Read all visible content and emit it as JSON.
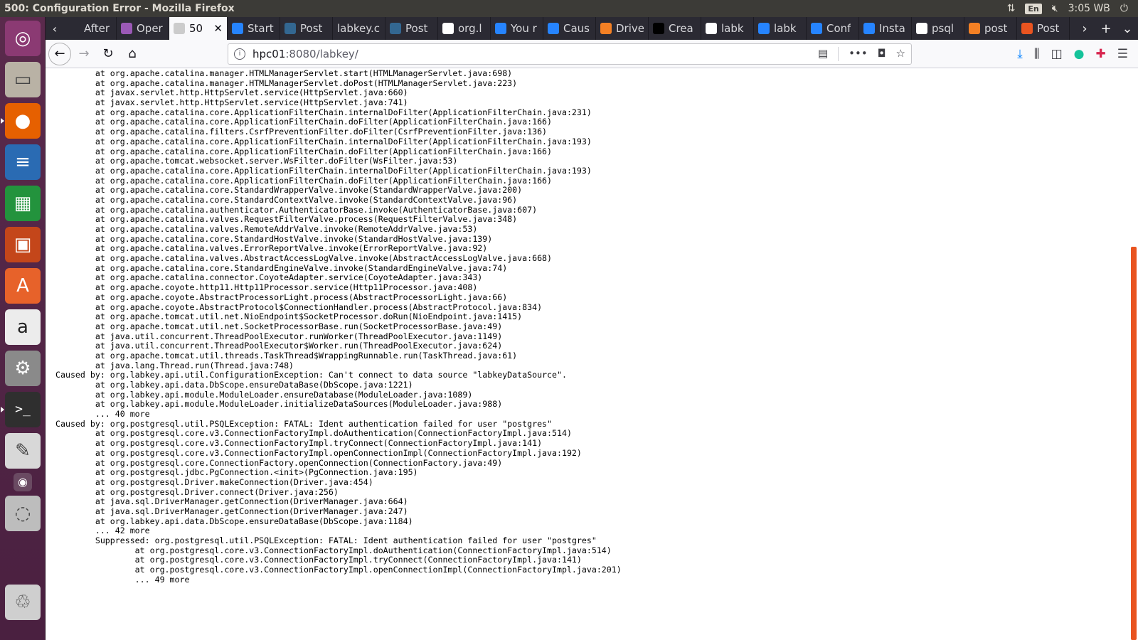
{
  "window": {
    "title": "500: Configuration Error - Mozilla Firefox",
    "tray": {
      "network_icon": "network-updown-icon",
      "keyboard": "En",
      "volume_icon": "volume-muted-icon",
      "clock": "3:05 WB",
      "power_icon": "power-icon"
    }
  },
  "launcher": {
    "items": [
      {
        "name": "ubuntu-dash-icon",
        "glyph": "◎",
        "color": "#8b3a73"
      },
      {
        "name": "files-icon",
        "glyph": "▭",
        "color": "#b9b2a5"
      },
      {
        "name": "firefox-icon",
        "glyph": "●",
        "color": "#e66000"
      },
      {
        "name": "writer-icon",
        "glyph": "≡",
        "color": "#2a6bb3"
      },
      {
        "name": "calc-icon",
        "glyph": "▦",
        "color": "#23933d"
      },
      {
        "name": "impress-icon",
        "glyph": "▣",
        "color": "#c4461a"
      },
      {
        "name": "software-center-icon",
        "glyph": "A",
        "color": "#e7622a"
      },
      {
        "name": "amazon-icon",
        "glyph": "a",
        "color": "#ececec"
      },
      {
        "name": "system-settings-icon",
        "glyph": "⚙",
        "color": "#8a8a8a"
      },
      {
        "name": "terminal-icon",
        "glyph": ">_",
        "color": "#2f2f2f"
      },
      {
        "name": "text-editor-icon",
        "glyph": "✎",
        "color": "#d8d8d8"
      },
      {
        "name": "camera-icon",
        "glyph": "◉",
        "color": "#6a4a62"
      },
      {
        "name": "disk-icon",
        "glyph": "◌",
        "color": "#bdbdbd"
      },
      {
        "name": "trash-icon",
        "glyph": "♲",
        "color": "#cfcfcf"
      }
    ]
  },
  "tabs": [
    {
      "label": "After",
      "icon": "back-arrow",
      "icon_color": "#2b2a33"
    },
    {
      "label": "Oper",
      "icon": "circle-icon",
      "icon_color": "#9b59b6"
    },
    {
      "label": "50",
      "icon": "image-icon",
      "icon_color": "#cccccc",
      "active": true
    },
    {
      "label": "Start",
      "icon": "atlassian-icon",
      "icon_color": "#2684ff"
    },
    {
      "label": "Post",
      "icon": "postgres-icon",
      "icon_color": "#336791"
    },
    {
      "label": "labkey.c",
      "icon": "",
      "icon_color": "#2b2a33"
    },
    {
      "label": "Post",
      "icon": "postgres-icon",
      "icon_color": "#336791"
    },
    {
      "label": "org.l",
      "icon": "google-icon",
      "icon_color": "#ffffff"
    },
    {
      "label": "You r",
      "icon": "atlassian-icon",
      "icon_color": "#2684ff"
    },
    {
      "label": "Caus",
      "icon": "atlassian-icon",
      "icon_color": "#2684ff"
    },
    {
      "label": "Drive",
      "icon": "stackoverflow-icon",
      "icon_color": "#f48024"
    },
    {
      "label": "Crea",
      "icon": "medium-icon",
      "icon_color": "#000000"
    },
    {
      "label": "labk",
      "icon": "google-icon",
      "icon_color": "#ffffff"
    },
    {
      "label": "labk",
      "icon": "atlassian-icon",
      "icon_color": "#2684ff"
    },
    {
      "label": "Conf",
      "icon": "atlassian-icon",
      "icon_color": "#2684ff"
    },
    {
      "label": "Insta",
      "icon": "atlassian-icon",
      "icon_color": "#2684ff"
    },
    {
      "label": "psql",
      "icon": "google-icon",
      "icon_color": "#ffffff"
    },
    {
      "label": "post",
      "icon": "stackoverflow-icon",
      "icon_color": "#f48024"
    },
    {
      "label": "Post",
      "icon": "ubuntu-icon",
      "icon_color": "#e95420"
    }
  ],
  "navbar": {
    "url_host": "hpc01",
    "url_rest": ":8080/labkey/",
    "more_label": "•••"
  },
  "trace_lines": [
    "        at org.apache.catalina.manager.HTMLManagerServlet.start(HTMLManagerServlet.java:698)",
    "        at org.apache.catalina.manager.HTMLManagerServlet.doPost(HTMLManagerServlet.java:223)",
    "        at javax.servlet.http.HttpServlet.service(HttpServlet.java:660)",
    "        at javax.servlet.http.HttpServlet.service(HttpServlet.java:741)",
    "        at org.apache.catalina.core.ApplicationFilterChain.internalDoFilter(ApplicationFilterChain.java:231)",
    "        at org.apache.catalina.core.ApplicationFilterChain.doFilter(ApplicationFilterChain.java:166)",
    "        at org.apache.catalina.filters.CsrfPreventionFilter.doFilter(CsrfPreventionFilter.java:136)",
    "        at org.apache.catalina.core.ApplicationFilterChain.internalDoFilter(ApplicationFilterChain.java:193)",
    "        at org.apache.catalina.core.ApplicationFilterChain.doFilter(ApplicationFilterChain.java:166)",
    "        at org.apache.tomcat.websocket.server.WsFilter.doFilter(WsFilter.java:53)",
    "        at org.apache.catalina.core.ApplicationFilterChain.internalDoFilter(ApplicationFilterChain.java:193)",
    "        at org.apache.catalina.core.ApplicationFilterChain.doFilter(ApplicationFilterChain.java:166)",
    "        at org.apache.catalina.core.StandardWrapperValve.invoke(StandardWrapperValve.java:200)",
    "        at org.apache.catalina.core.StandardContextValve.invoke(StandardContextValve.java:96)",
    "        at org.apache.catalina.authenticator.AuthenticatorBase.invoke(AuthenticatorBase.java:607)",
    "        at org.apache.catalina.valves.RequestFilterValve.process(RequestFilterValve.java:348)",
    "        at org.apache.catalina.valves.RemoteAddrValve.invoke(RemoteAddrValve.java:53)",
    "        at org.apache.catalina.core.StandardHostValve.invoke(StandardHostValve.java:139)",
    "        at org.apache.catalina.valves.ErrorReportValve.invoke(ErrorReportValve.java:92)",
    "        at org.apache.catalina.valves.AbstractAccessLogValve.invoke(AbstractAccessLogValve.java:668)",
    "        at org.apache.catalina.core.StandardEngineValve.invoke(StandardEngineValve.java:74)",
    "        at org.apache.catalina.connector.CoyoteAdapter.service(CoyoteAdapter.java:343)",
    "        at org.apache.coyote.http11.Http11Processor.service(Http11Processor.java:408)",
    "        at org.apache.coyote.AbstractProcessorLight.process(AbstractProcessorLight.java:66)",
    "        at org.apache.coyote.AbstractProtocol$ConnectionHandler.process(AbstractProtocol.java:834)",
    "        at org.apache.tomcat.util.net.NioEndpoint$SocketProcessor.doRun(NioEndpoint.java:1415)",
    "        at org.apache.tomcat.util.net.SocketProcessorBase.run(SocketProcessorBase.java:49)",
    "        at java.util.concurrent.ThreadPoolExecutor.runWorker(ThreadPoolExecutor.java:1149)",
    "        at java.util.concurrent.ThreadPoolExecutor$Worker.run(ThreadPoolExecutor.java:624)",
    "        at org.apache.tomcat.util.threads.TaskThread$WrappingRunnable.run(TaskThread.java:61)",
    "        at java.lang.Thread.run(Thread.java:748)",
    "Caused by: org.labkey.api.util.ConfigurationException: Can't connect to data source \"labkeyDataSource\".",
    "        at org.labkey.api.data.DbScope.ensureDataBase(DbScope.java:1221)",
    "        at org.labkey.api.module.ModuleLoader.ensureDatabase(ModuleLoader.java:1089)",
    "        at org.labkey.api.module.ModuleLoader.initializeDataSources(ModuleLoader.java:988)",
    "        ... 40 more",
    "Caused by: org.postgresql.util.PSQLException: FATAL: Ident authentication failed for user \"postgres\"",
    "        at org.postgresql.core.v3.ConnectionFactoryImpl.doAuthentication(ConnectionFactoryImpl.java:514)",
    "        at org.postgresql.core.v3.ConnectionFactoryImpl.tryConnect(ConnectionFactoryImpl.java:141)",
    "        at org.postgresql.core.v3.ConnectionFactoryImpl.openConnectionImpl(ConnectionFactoryImpl.java:192)",
    "        at org.postgresql.core.ConnectionFactory.openConnection(ConnectionFactory.java:49)",
    "        at org.postgresql.jdbc.PgConnection.<init>(PgConnection.java:195)",
    "        at org.postgresql.Driver.makeConnection(Driver.java:454)",
    "        at org.postgresql.Driver.connect(Driver.java:256)",
    "        at java.sql.DriverManager.getConnection(DriverManager.java:664)",
    "        at java.sql.DriverManager.getConnection(DriverManager.java:247)",
    "        at org.labkey.api.data.DbScope.ensureDataBase(DbScope.java:1184)",
    "        ... 42 more",
    "        Suppressed: org.postgresql.util.PSQLException: FATAL: Ident authentication failed for user \"postgres\"",
    "                at org.postgresql.core.v3.ConnectionFactoryImpl.doAuthentication(ConnectionFactoryImpl.java:514)",
    "                at org.postgresql.core.v3.ConnectionFactoryImpl.tryConnect(ConnectionFactoryImpl.java:141)",
    "                at org.postgresql.core.v3.ConnectionFactoryImpl.openConnectionImpl(ConnectionFactoryImpl.java:201)",
    "                ... 49 more"
  ],
  "colors": {
    "scroll_thumb": "#e95420",
    "launcher": "#5a2a4c"
  }
}
